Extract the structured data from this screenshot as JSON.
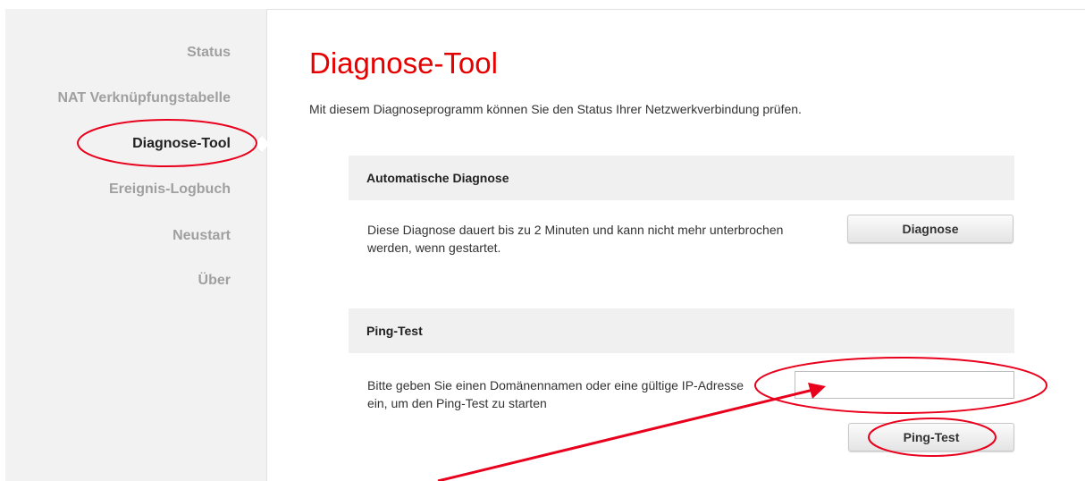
{
  "sidebar": {
    "items": [
      {
        "label": "Status"
      },
      {
        "label": "NAT Verknüpfungstabelle"
      },
      {
        "label": "Diagnose-Tool"
      },
      {
        "label": "Ereignis-Logbuch"
      },
      {
        "label": "Neustart"
      },
      {
        "label": "Über"
      }
    ],
    "active_item": "Diagnose-Tool"
  },
  "main": {
    "title": "Diagnose-Tool",
    "description": "Mit diesem Diagnoseprogramm können Sie den Status Ihrer Netzwerkverbindung prüfen.",
    "auto_diagnosis": {
      "header": "Automatische Diagnose",
      "text": "Diese Diagnose dauert bis zu 2 Minuten und kann nicht mehr unterbrochen werden, wenn gestartet.",
      "button_label": "Diagnose"
    },
    "ping_test": {
      "header": "Ping-Test",
      "text": "Bitte geben Sie einen Domänennamen oder eine gültige IP-Adresse ein, um den Ping-Test zu starten",
      "input_value": "",
      "button_label": "Ping-Test"
    }
  },
  "colors": {
    "accent": "#e60000",
    "annotation": "#e8001c",
    "sidebar_bg": "#f2f2f2",
    "section_bg": "#f0f0f0"
  },
  "icons": {
    "nav_pointer": "caret-left-icon"
  }
}
